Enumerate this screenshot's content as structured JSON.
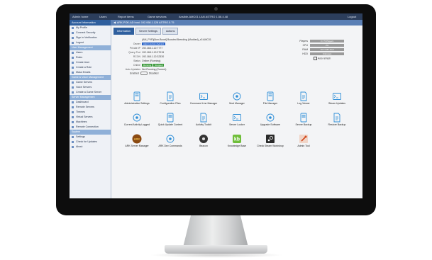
{
  "topbar": {
    "items": [
      "Admin home",
      "Users",
      "Report items",
      "Game services",
      "Ansible-AMC01 LAN ASTRO 1.56.4.48"
    ],
    "right": "Logout"
  },
  "sidebar": {
    "header": "Account Information",
    "sections": [
      {
        "title": "",
        "items": [
          "My Profile",
          "Connect Security",
          "Sign in Verification",
          "Logout"
        ]
      },
      {
        "title": "User Management",
        "items": [
          "Users",
          "Roles",
          "Create User",
          "Create a Role",
          "Mass Emails"
        ]
      },
      {
        "title": "Game & Voice Management",
        "items": [
          "Game Servers",
          "Voice Servers",
          "Create a Game Server"
        ]
      },
      {
        "title": "Server Management",
        "items": [
          "Dashboard",
          "Remote Servers",
          "Themes",
          "Virtual Servers",
          "Machines",
          "Remote Connection"
        ]
      },
      {
        "title": "System",
        "items": [
          "Settings",
          "Check for Updates",
          "About"
        ]
      }
    ]
  },
  "subbar": {
    "text": "ARK-POK-AD host: 192.068.1.128 ASTRO.5.75"
  },
  "tabs": [
    "Information",
    "Server Settings",
    "Actions"
  ],
  "info": [
    {
      "k": "",
      "v": "(AM_PVP)[Non-Boost] Boosted Breeding (Modded)_x3 AMC01"
    },
    {
      "k": "Owner",
      "v": "",
      "pill": "Admin Admin (Admin)",
      "pill_color": "#2a64c8"
    },
    {
      "k": "Private IP",
      "v": "192.168.1.12:7777"
    },
    {
      "k": "Query Port",
      "v": "192.168.1.12:27015"
    },
    {
      "k": "RCON",
      "v": "192.168.1.12:32330"
    },
    {
      "k": "Status",
      "v": "Online (Running)"
    },
    {
      "k": "Online",
      "v": "",
      "pill": "Running",
      "pill_color": "#3c9a3c",
      "pill2": "Stopped",
      "pill2_color": "#3c9a3c"
    },
    {
      "k": "Auto Updates",
      "v": "Not Running (Current)"
    }
  ],
  "toggle": {
    "on": "Enabled",
    "off": "Disabled"
  },
  "right_panel": [
    {
      "k": "Players",
      "v": "0 / 70 Players"
    },
    {
      "k": "CPU",
      "v": "2%"
    },
    {
      "k": "RAM",
      "v": "10.0 GB Used"
    },
    {
      "k": "HDD",
      "v": "Unknown"
    }
  ],
  "right_check": "Auto refresh",
  "tiles": [
    {
      "label": "Administrative Settings",
      "icon": "admin-settings-icon",
      "color": "#2f8fd8"
    },
    {
      "label": "Configuration Files",
      "icon": "config-files-icon",
      "color": "#2f8fd8"
    },
    {
      "label": "Command Line Manager",
      "icon": "command-line-icon",
      "color": "#2f8fd8"
    },
    {
      "label": "Mod Manager",
      "icon": "mod-manager-icon",
      "color": "#2f8fd8"
    },
    {
      "label": "File Manager",
      "icon": "file-manager-icon",
      "color": "#2f8fd8"
    },
    {
      "label": "Log Viewer",
      "icon": "log-viewer-icon",
      "color": "#2f8fd8"
    },
    {
      "label": "Steam Updates",
      "icon": "steam-updates-icon",
      "color": "#2f8fd8"
    },
    {
      "label": "Current Activity Logged",
      "icon": "activity-icon",
      "color": "#2f8fd8"
    },
    {
      "label": "Quick Update Content",
      "icon": "quick-update-icon",
      "color": "#2f8fd8"
    },
    {
      "label": "Activity Toolkit",
      "icon": "toolkit-icon",
      "color": "#2f8fd8"
    },
    {
      "label": "Server Locker",
      "icon": "server-locker-icon",
      "color": "#2f8fd8"
    },
    {
      "label": "Upgrade Software",
      "icon": "upgrade-icon",
      "color": "#2f8fd8"
    },
    {
      "label": "Server Backup",
      "icon": "server-backup-icon",
      "color": "#2f8fd8"
    },
    {
      "label": "Restore Backup",
      "icon": "restore-backup-icon",
      "color": "#2f8fd8"
    },
    {
      "label": "ARK Server Manager",
      "icon": "ark-logo-icon",
      "color": "#8a4a12"
    },
    {
      "label": "ARK Dev Commands",
      "icon": "dev-commands-icon",
      "color": "#2f8fd8"
    },
    {
      "label": "Beacon",
      "icon": "beacon-icon",
      "color": "#333333"
    },
    {
      "label": "Knowledge Base",
      "icon": "knowledge-base-icon",
      "color": "#6fbe3a"
    },
    {
      "label": "Check Steam Workshop",
      "icon": "steam-icon",
      "color": "#2a2a2a"
    },
    {
      "label": "Admin Tool",
      "icon": "admin-tool-icon",
      "color": "#d24a1f"
    }
  ]
}
